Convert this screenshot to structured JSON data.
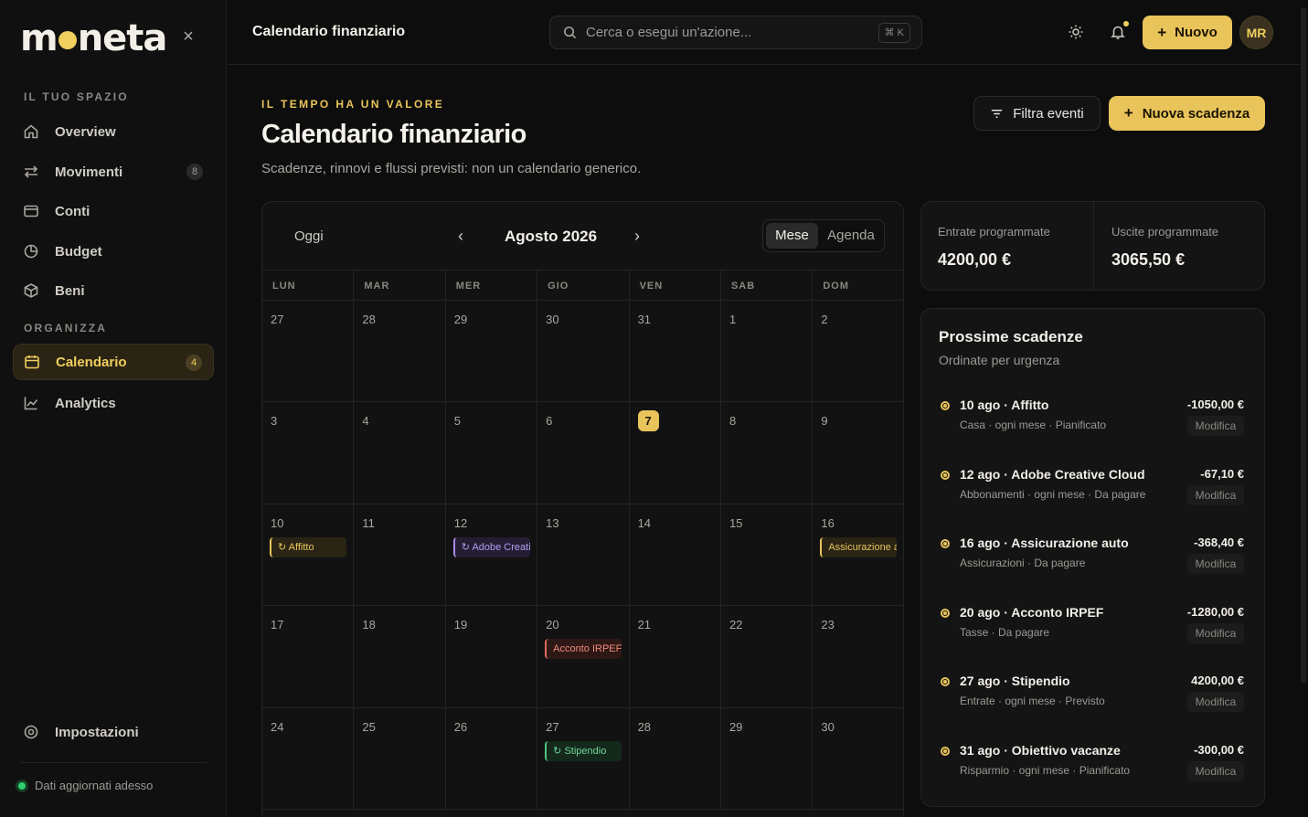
{
  "brand": {
    "name_pre": "m",
    "name_post": "neta"
  },
  "sidebar": {
    "section1": "IL TUO SPAZIO",
    "section2": "ORGANIZZA",
    "items": [
      {
        "label": "Overview",
        "icon": "home-icon"
      },
      {
        "label": "Movimenti",
        "icon": "transfer-icon",
        "badge": "8"
      },
      {
        "label": "Conti",
        "icon": "wallet-icon"
      },
      {
        "label": "Budget",
        "icon": "pie-icon"
      },
      {
        "label": "Beni",
        "icon": "box-icon"
      },
      {
        "label": "Calendario",
        "icon": "calendar-icon",
        "badge": "4",
        "active": true
      },
      {
        "label": "Analytics",
        "icon": "chart-icon"
      }
    ],
    "settings": "Impostazioni",
    "status": "Dati aggiornati adesso"
  },
  "header": {
    "title": "Calendario finanziario",
    "search_placeholder": "Cerca o esegui un'azione...",
    "shortcut": "⌘ K",
    "new_label": "Nuovo",
    "avatar": "MR"
  },
  "page": {
    "eyebrow": "IL TEMPO HA UN VALORE",
    "title": "Calendario finanziario",
    "subtitle": "Scadenze, rinnovi e flussi previsti: non un calendario generico.",
    "filter_label": "Filtra eventi",
    "new_deadline_label": "Nuova scadenza"
  },
  "calendar": {
    "today_label": "Oggi",
    "month": "Agosto 2026",
    "view_month": "Mese",
    "view_agenda": "Agenda",
    "weekdays": [
      "LUN",
      "MAR",
      "MER",
      "GIO",
      "VEN",
      "SAB",
      "DOM"
    ],
    "weeks": [
      [
        "27",
        "28",
        "29",
        "30",
        "31",
        "1",
        "2"
      ],
      [
        "3",
        "4",
        "5",
        "6",
        "7",
        "8",
        "9"
      ],
      [
        "10",
        "11",
        "12",
        "13",
        "14",
        "15",
        "16"
      ],
      [
        "17",
        "18",
        "19",
        "20",
        "21",
        "22",
        "23"
      ],
      [
        "24",
        "25",
        "26",
        "27",
        "28",
        "29",
        "30"
      ]
    ],
    "events": {
      "affitto": "↻ Affitto",
      "adobe": "↻ Adobe Creative Cloud",
      "assicurazione": "Assicurazione auto",
      "irpef": "Acconto IRPEF",
      "stipendio": "↻ Stipendio"
    }
  },
  "summary": {
    "in_label": "Entrate programmate",
    "in_value": "4200,00 €",
    "out_label": "Uscite programmate",
    "out_value": "3065,50 €"
  },
  "upcoming": {
    "title": "Prossime scadenze",
    "subtitle": "Ordinate per urgenza",
    "edit_label": "Modifica",
    "items": [
      {
        "title": "10 ago · Affitto",
        "meta": "Casa · ogni mese · Pianificato",
        "amount": "-1050,00 €"
      },
      {
        "title": "12 ago · Adobe Creative Cloud",
        "meta": "Abbonamenti · ogni mese · Da pagare",
        "amount": "-67,10 €"
      },
      {
        "title": "16 ago · Assicurazione auto",
        "meta": "Assicurazioni · Da pagare",
        "amount": "-368,40 €"
      },
      {
        "title": "20 ago · Acconto IRPEF",
        "meta": "Tasse · Da pagare",
        "amount": "-1280,00 €"
      },
      {
        "title": "27 ago · Stipendio",
        "meta": "Entrate · ogni mese · Previsto",
        "amount": "4200,00 €"
      },
      {
        "title": "31 ago · Obiettivo vacanze",
        "meta": "Risparmio · ogni mese · Pianificato",
        "amount": "-300,00 €"
      }
    ]
  }
}
